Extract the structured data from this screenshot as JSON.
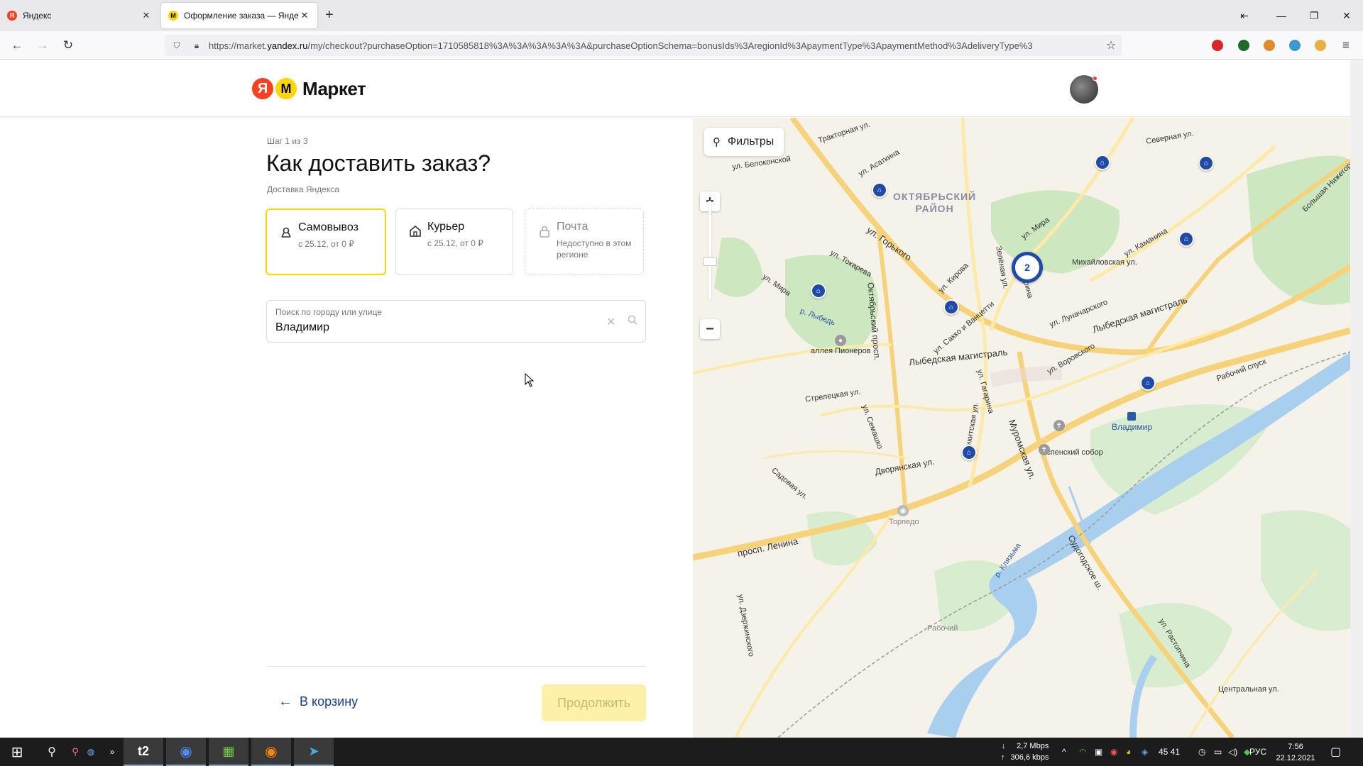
{
  "browser": {
    "tabs": [
      {
        "title": "Яндекс"
      },
      {
        "title": "Оформление заказа — Яндекс"
      }
    ],
    "url_prefix": "https://market.",
    "url_domain": "yandex.ru",
    "url_rest": "/my/checkout?purchaseOption=1710585818%3A%3A%3A%3A%3A&purchaseOptionSchema=bonusIds%3AregionId%3ApaymentType%3ApaymentMethod%3AdeliveryType%3"
  },
  "header": {
    "logo_ya": "Я",
    "logo_m": "M",
    "logo_text": "Маркет"
  },
  "checkout": {
    "step": "Шаг 1 из 3",
    "title": "Как доставить заказ?",
    "subtitle": "Доставка Яндекса",
    "options": [
      {
        "title": "Самовывоз",
        "sub": "с 25.12, от 0 ₽",
        "icon": "pickup-icon"
      },
      {
        "title": "Курьер",
        "sub": "с 25.12, от 0 ₽",
        "icon": "house-icon"
      },
      {
        "title": "Почта",
        "sub": "Недоступно в этом регионе",
        "icon": "lock-icon"
      }
    ],
    "search": {
      "label": "Поиск по городу или улице",
      "value": "Владимир"
    },
    "back_label": "В корзину",
    "continue_label": "Продолжить"
  },
  "map": {
    "filters_label": "Фильтры",
    "cluster_count": "2",
    "district": "ОКТЯБРЬСКИЙ\nРАЙОН",
    "labels": [
      {
        "text": "Тракторная ул."
      },
      {
        "text": "ул. Асаткина"
      },
      {
        "text": "ул. Белоконской"
      },
      {
        "text": "ул. Горького"
      },
      {
        "text": "ул. Токарева"
      },
      {
        "text": "ул. Мира"
      },
      {
        "text": "ул. Мира"
      },
      {
        "text": "Октябрьский просп."
      },
      {
        "text": "ул. Кирова"
      },
      {
        "text": "Зелёная ул."
      },
      {
        "text": "Батурина"
      },
      {
        "text": "Михайловская ул."
      },
      {
        "text": "ул. Луначарского"
      },
      {
        "text": "Лыбедская магистраль"
      },
      {
        "text": "Лыбедская магистраль"
      },
      {
        "text": "ул. Сакко и Ванцетти"
      },
      {
        "text": "ул. Воровского"
      },
      {
        "text": "аллея Пионеров"
      },
      {
        "text": "Стрелецкая ул."
      },
      {
        "text": "ул. Гагарина"
      },
      {
        "text": "ул. Семашко"
      },
      {
        "text": "Никитская ул."
      },
      {
        "text": "Муромская ул."
      },
      {
        "text": "Дворянская ул."
      },
      {
        "text": "Садовая ул."
      },
      {
        "text": "просп. Ленина"
      },
      {
        "text": "Торпедо"
      },
      {
        "text": "Успенский собор"
      },
      {
        "text": "Владимир"
      },
      {
        "text": "Судогодское ш."
      },
      {
        "text": "Рабочий"
      },
      {
        "text": "Северная ул."
      },
      {
        "text": "Большая Нижегородская"
      },
      {
        "text": "ул. Каманина"
      },
      {
        "text": "р. Лыбедь"
      },
      {
        "text": "р. Клязьма"
      },
      {
        "text": "ул. Дзержинского"
      },
      {
        "text": "Центральная ул."
      },
      {
        "text": "ул. Растопчина"
      },
      {
        "text": "Рабочий спуск"
      }
    ]
  },
  "taskbar": {
    "net_down": "2,7 Mbps",
    "net_up": "306,6 kbps",
    "tray_nums": "45  41",
    "lang": "РУС",
    "time": "7:56",
    "date": "22.12.2021"
  },
  "colors": {
    "accent": "#ffd600",
    "brand_red": "#fc3f1d",
    "pin": "#1f4aa8"
  }
}
